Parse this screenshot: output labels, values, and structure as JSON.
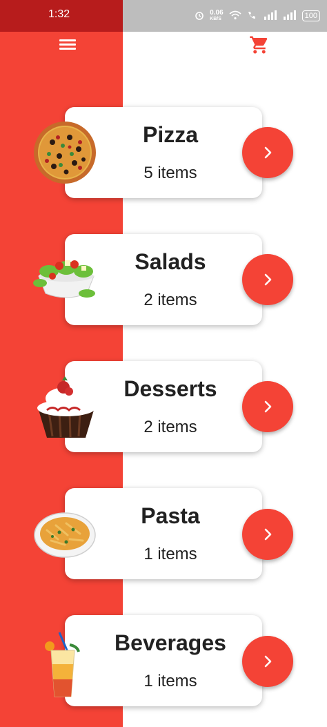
{
  "status": {
    "time": "1:32",
    "speed_value": "0.06",
    "speed_unit": "KB/S",
    "battery": "100"
  },
  "colors": {
    "accent": "#f44336",
    "status_left": "#b71c1c"
  },
  "categories": [
    {
      "name": "Pizza",
      "count": "5 items",
      "icon": "pizza-icon"
    },
    {
      "name": "Salads",
      "count": "2 items",
      "icon": "salad-icon"
    },
    {
      "name": "Desserts",
      "count": "2 items",
      "icon": "dessert-icon"
    },
    {
      "name": "Pasta",
      "count": "1 items",
      "icon": "pasta-icon"
    },
    {
      "name": "Beverages",
      "count": "1 items",
      "icon": "beverage-icon"
    }
  ]
}
